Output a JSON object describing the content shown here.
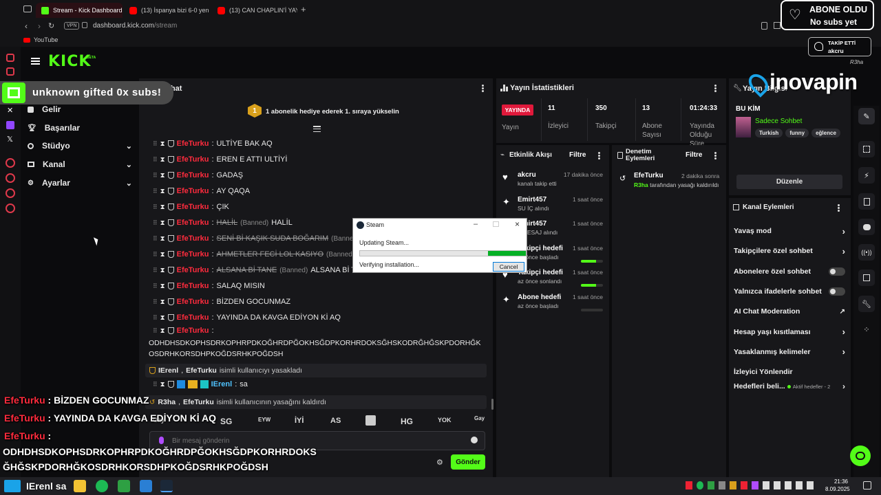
{
  "browser": {
    "tabs": [
      {
        "label": "Stream - Kick Dashboard"
      },
      {
        "label": "(13) İspanya bizi 6-0 yenc"
      },
      {
        "label": "(13) CAN CHAPLIN'İ YAYI"
      }
    ],
    "vpn_label": "VPN",
    "url_domain": "dashboard.kick.com",
    "url_path": "/stream",
    "bookmark": "YouTube"
  },
  "kick": {
    "logo": "KICK",
    "logo_sup": "BETA",
    "follow_badge": {
      "line1": "TAKİP ETTİ",
      "line2": "akcru"
    },
    "user_label": "R3ha"
  },
  "sidebar": {
    "items": [
      {
        "label": "Gelir"
      },
      {
        "label": "Başarılar"
      },
      {
        "label": "Stüdyo"
      },
      {
        "label": "Kanal"
      },
      {
        "label": "Ayarlar"
      }
    ]
  },
  "chat": {
    "title": "Chat",
    "pinned": "1 abonelik hediye ederek 1. sıraya yükselin",
    "pinned_rank": "1",
    "messages": [
      {
        "user": "EfeTurku",
        "text": "ULTİYE BAK AQ"
      },
      {
        "user": "EfeTurku",
        "text": "EREN E ATTI ULTİYİ"
      },
      {
        "user": "EfeTurku",
        "text": "GADAŞ"
      },
      {
        "user": "EfeTurku",
        "text": "AY QAQA"
      },
      {
        "user": "EfeTurku",
        "text": "ÇIK"
      },
      {
        "user": "EfeTurku",
        "struck": "HALİL",
        "banned": "(Banned)",
        "text": "HALİL"
      },
      {
        "user": "EfeTurku",
        "struck": "SENİ Bİ KAŞIK SUDA BOĞARIM",
        "banned": "(Banned)",
        "text": ""
      },
      {
        "user": "EfeTurku",
        "struck": "AHMETLER FECİ LOL KASIYO",
        "banned": "(Banned)",
        "text": ""
      },
      {
        "user": "EfeTurku",
        "struck": "ALSANA Bİ TANE",
        "banned": "(Banned)",
        "text": "ALSANA Bİ T"
      },
      {
        "user": "EfeTurku",
        "text": "SALAQ MISIN"
      },
      {
        "user": "EfeTurku",
        "text": "BİZDEN GOCUNMAZ"
      },
      {
        "user": "EfeTurku",
        "text": "YAYINDA DA KAVGA EDİYON Kİ AQ"
      }
    ],
    "long_user": "EfeTurku",
    "long_line1": "ODHDHSDKOPHSDRKOPHRPDKOĞHRDPĞOKHSĞDPKORHRDOKSĞHSKODRĞHĞSKPDORHĞK",
    "long_line2": "OSDRHKORSDHPKOĞDSRHKPOĞDSH",
    "ban_notice": {
      "actor": "IErenl",
      "target": "EfeTurku",
      "text": "isimli kullanıcıyı yasakladı"
    },
    "last_user": "IErenl",
    "last_text": "sa",
    "unban_notice": {
      "actor": "R3ha",
      "target": "EfeTurku",
      "text": "isimli kullanıcının yasağını kaldırdı"
    },
    "emotes": [
      "SG",
      "EYW",
      "İYİ",
      "AS",
      "HG",
      "YOK",
      "Gay"
    ],
    "input_placeholder": "Bir mesaj gönderin",
    "send_label": "Gönder"
  },
  "stats": {
    "title": "Yayın İstatistikleri",
    "live_badge": "YAYINDA",
    "live_label": "Yayın",
    "cells": [
      {
        "value": "11",
        "label": "İzleyici"
      },
      {
        "value": "350",
        "label": "Takipçi"
      },
      {
        "value": "13",
        "label": "Abone Sayısı"
      },
      {
        "value": "01:24:33",
        "label": "Yayında Olduğu Süre"
      }
    ]
  },
  "activity": {
    "title": "Etkinlik Akışı",
    "filter": "Filtre",
    "items": [
      {
        "title": "akcru",
        "sub": "kanalı takip etti",
        "time": "17 dakika önce",
        "icon": "heart-icon"
      },
      {
        "title": "Emirt457",
        "sub": "SU İÇ alındı",
        "time": "1 saat önce",
        "icon": "reward-icon"
      },
      {
        "title": "Emirt457",
        "sub": "L MESAJ alındı",
        "time": "1 saat önce",
        "icon": "reward-icon"
      },
      {
        "title": "Takipçi hedefi",
        "sub": "az önce başladı",
        "time": "1 saat önce",
        "icon": "goal-icon",
        "progress": 0.7
      },
      {
        "title": "Takipçi hedefi",
        "sub": "az önce sonlandı",
        "time": "1 saat önce",
        "icon": "heart-icon",
        "progress": 0.7
      },
      {
        "title": "Abone hedefi",
        "sub": "az önce başladı",
        "time": "1 saat önce",
        "icon": "star-icon",
        "progress": 0.0
      }
    ]
  },
  "moderation": {
    "title": "Denetim Eylemleri",
    "filter": "Filtre",
    "item": {
      "user": "EfeTurku",
      "time": "2 dakika sonra",
      "actor": "R3ha",
      "text": "tarafından yasağı kaldırıldı"
    }
  },
  "stream_info": {
    "title": "Yayın Bilgisi",
    "who": "BU KİM",
    "category": "Sadece Sohbet",
    "tags": [
      "Turkish",
      "funny",
      "eğlence"
    ],
    "edit": "Düzenle"
  },
  "channel_actions": {
    "title": "Kanal Eylemleri",
    "items": [
      {
        "label": "Yavaş mod",
        "control": "chevron"
      },
      {
        "label": "Takipçilere özel sohbet",
        "control": "chevron"
      },
      {
        "label": "Abonelere özel sohbet",
        "control": "toggle"
      },
      {
        "label": "Yalnızca ifadelerle sohbet",
        "control": "toggle"
      },
      {
        "label": "AI Chat Moderation",
        "control": "external"
      },
      {
        "label": "Hesap yaşı kısıtlaması",
        "control": "chevron"
      },
      {
        "label": "Yasaklanmış kelimeler",
        "control": "chevron"
      },
      {
        "label": "İzleyici Yönlendir",
        "control": "none"
      }
    ],
    "goals_label": "Hedefleri beli...",
    "goals_status": "Aktif hedefler - 2"
  },
  "overlays": {
    "sub_title": "ABONE OLDU",
    "sub_sub": "No subs yet",
    "gifted": "unknown gifted 0x subs!",
    "brand": "inovapin",
    "chat_lines": [
      {
        "user": "EfeTurku",
        "text": ": BİZDEN GOCUNMAZ"
      },
      {
        "user": "EfeTurku",
        "text": ": YAYINDA DA KAVGA EDİYON Kİ AQ"
      },
      {
        "user": "EfeTurku",
        "text": ":"
      }
    ],
    "long1": "ODHDHSDKOPHSDRKOPHRPDKOĞHRDPĞOKHSĞDPKORHRDOKS",
    "long2": "ĞHĞSKPDORHĞKOSDRHKORSDHPKOĞDSRHKPOĞDSH",
    "bottom_name": "IErenl",
    "bottom_text": "sa"
  },
  "steam_dialog": {
    "title": "Steam",
    "status": "Updating Steam...",
    "progress": 0.23,
    "sub_status": "Verifying installation...",
    "cancel": "Cancel"
  },
  "taskbar": {
    "time": "21:36",
    "date": "8.09.2025"
  }
}
